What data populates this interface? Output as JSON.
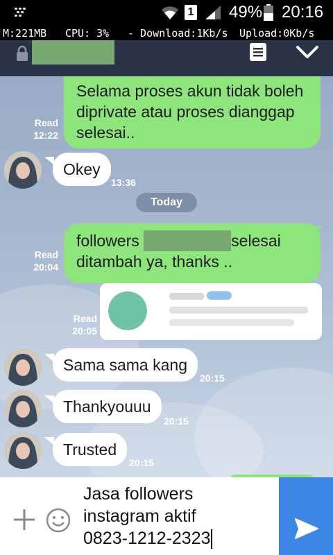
{
  "status_bar": {
    "sim_slot": "1",
    "battery_percent": "49%",
    "time": "20:16"
  },
  "monitor": {
    "memory": "M:221MB",
    "cpu": "CPU: 3%",
    "download": "- Download:1Kb/s",
    "upload": "Upload:0Kb/s"
  },
  "header": {
    "notes_icon": "notes-icon",
    "collapse_icon": "chevron-down-icon"
  },
  "chat": {
    "messages": [
      {
        "direction": "out",
        "text_lines": [
          "Selama proses akun tidak boleh",
          "diprivate atau proses dianggap",
          "selesai.."
        ],
        "read_label": "Read",
        "time": "12:22"
      },
      {
        "direction": "in",
        "text": "Okey",
        "time": "13:36"
      },
      {
        "direction": "out",
        "text_before": "followers ",
        "text_after": "selesai",
        "text_line2": "ditambah ya, thanks ..",
        "read_label": "Read",
        "time": "20:04"
      },
      {
        "direction": "out",
        "type": "link-card",
        "read_label": "Read",
        "time": "20:05"
      },
      {
        "direction": "in",
        "text": "Sama sama kang",
        "time": "20:15"
      },
      {
        "direction": "in",
        "text": "Thankyouuu",
        "time": "20:15"
      },
      {
        "direction": "in",
        "text": "Trusted",
        "time": "20:15"
      }
    ],
    "day_separator": "Today"
  },
  "input": {
    "lines": [
      "Jasa followers",
      "instagram aktif",
      "0823-1212-2323"
    ]
  },
  "colors": {
    "outgoing_bubble": "#8ee57b",
    "incoming_bubble": "#ffffff",
    "header": "#2a3345",
    "send_button": "#3d86e5"
  }
}
